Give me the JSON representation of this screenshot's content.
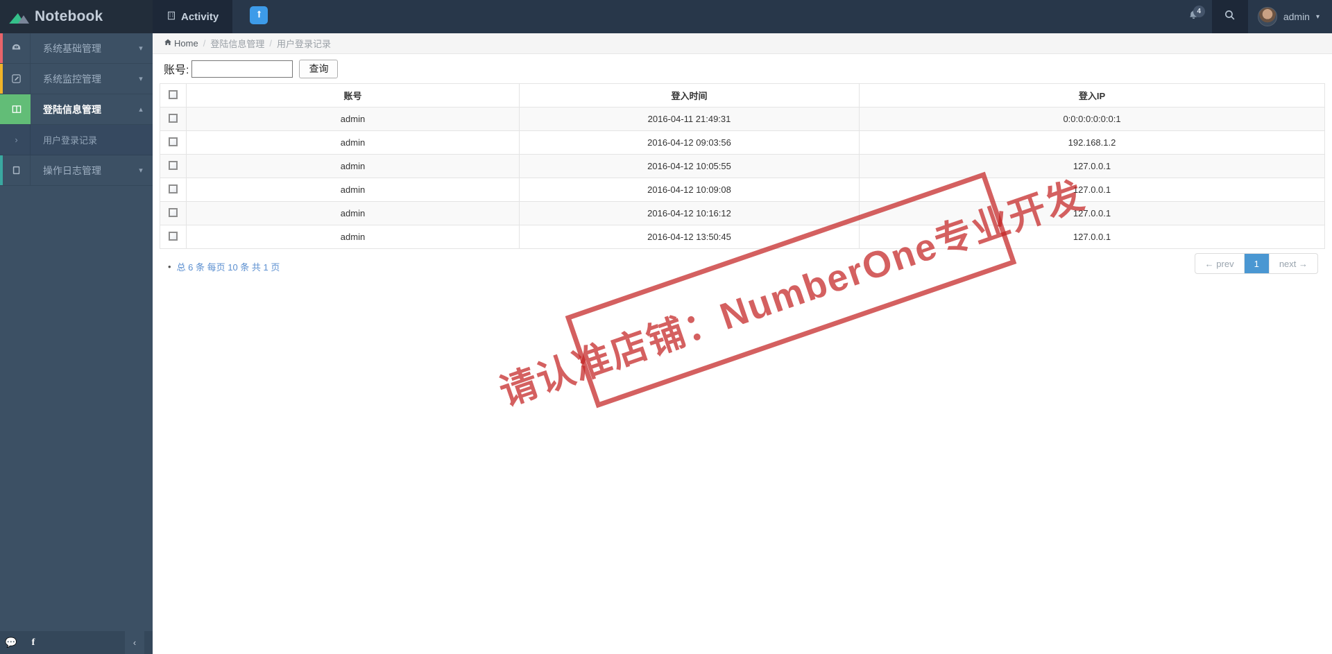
{
  "brand": {
    "title": "Notebook",
    "logo_icon": "notebook-logo-icon"
  },
  "sidebar": {
    "items": [
      {
        "label": "系统基础管理",
        "icon": "dashboard-icon",
        "accent": "#e8646a",
        "caret": "chevron-down-icon",
        "active": false
      },
      {
        "label": "系统监控管理",
        "icon": "pencil-icon",
        "accent": "#f0b429",
        "caret": "chevron-down-icon",
        "active": false
      },
      {
        "label": "登陆信息管理",
        "icon": "columns-icon",
        "accent": "#62bd77",
        "caret": "chevron-up-icon",
        "active": true
      }
    ],
    "submenu": [
      {
        "label": "用户登录记录",
        "icon": "chevron-right-icon"
      }
    ],
    "items_after": [
      {
        "label": "操作日志管理",
        "icon": "book-icon",
        "accent": "#3aa8a0",
        "caret": "chevron-down-icon",
        "active": false
      }
    ],
    "footer": {
      "chat_icon": "chat-bubble-icon",
      "facebook_icon": "facebook-icon",
      "collapse_icon": "chevron-left-icon"
    }
  },
  "topbar": {
    "tab_label": "Activity",
    "tab_icon": "building-icon",
    "badge_icon": "upload-person-icon",
    "bell_icon": "bell-icon",
    "bell_count": "4",
    "search_icon": "search-icon",
    "user_name": "admin",
    "user_caret": "caret-down-icon",
    "avatar_icon": "avatar"
  },
  "breadcrumb": {
    "home_icon": "home-icon",
    "home": "Home",
    "separator": "/",
    "crumb1": "登陆信息管理",
    "crumb2": "用户登录记录"
  },
  "filter": {
    "label": "账号:",
    "input_value": "",
    "input_placeholder": "",
    "button_label": "查询"
  },
  "table": {
    "headers": [
      "账号",
      "登入时间",
      "登入IP"
    ],
    "rows": [
      {
        "account": "admin",
        "time": "2016-04-11 21:49:31",
        "ip": "0:0:0:0:0:0:0:1"
      },
      {
        "account": "admin",
        "time": "2016-04-12 09:03:56",
        "ip": "192.168.1.2"
      },
      {
        "account": "admin",
        "time": "2016-04-12 10:05:55",
        "ip": "127.0.0.1"
      },
      {
        "account": "admin",
        "time": "2016-04-12 10:09:08",
        "ip": "127.0.0.1"
      },
      {
        "account": "admin",
        "time": "2016-04-12 10:16:12",
        "ip": "127.0.0.1"
      },
      {
        "account": "admin",
        "time": "2016-04-12 13:50:45",
        "ip": "127.0.0.1"
      }
    ]
  },
  "pager": {
    "total_text": "总 6 条 每页 10 条 共 1 页",
    "prev_label": "← prev",
    "current_page": "1",
    "next_label": "next →"
  },
  "watermark": {
    "text": "请认准店铺：NumberOne专业开发",
    "color": "#c42222"
  }
}
